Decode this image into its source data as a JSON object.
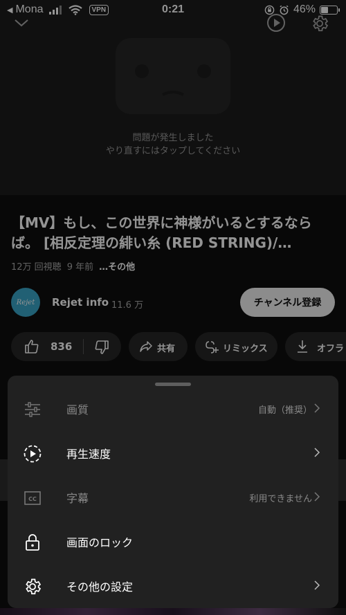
{
  "status_bar": {
    "back_label": "◀",
    "carrier": "Mona",
    "vpn": "VPN",
    "time": "0:21",
    "battery": "46%",
    "battery_level": 0.46
  },
  "video": {
    "error_line1": "問題が発生しました",
    "error_line2": "やり直すにはタップしてください"
  },
  "details": {
    "title": "【MV】もし、この世界に神様がいるとするならば。 [相反定理の緋い糸 (RED STRING)/…",
    "views": "12万 回視聴",
    "age": "9 年前",
    "more": "…その他"
  },
  "channel": {
    "avatar_text": "Rejet",
    "name": "Rejet info",
    "subs": "11.6 万",
    "subscribe_label": "チャンネル登録"
  },
  "actions": {
    "like_count": "836",
    "share_label": "共有",
    "remix_label": "リミックス",
    "offline_label": "オフラ"
  },
  "sheet": {
    "items": [
      {
        "label": "画質",
        "value": "自動（推奨）",
        "icon": "sliders-icon",
        "enabled": false
      },
      {
        "label": "再生速度",
        "value": "",
        "icon": "playback-speed-icon",
        "enabled": true
      },
      {
        "label": "字幕",
        "value": "利用できません",
        "icon": "cc-icon",
        "enabled": false
      },
      {
        "label": "画面のロック",
        "value": "",
        "icon": "lock-icon",
        "enabled": true
      },
      {
        "label": "その他の設定",
        "value": "",
        "icon": "gear-icon",
        "enabled": true
      }
    ]
  }
}
